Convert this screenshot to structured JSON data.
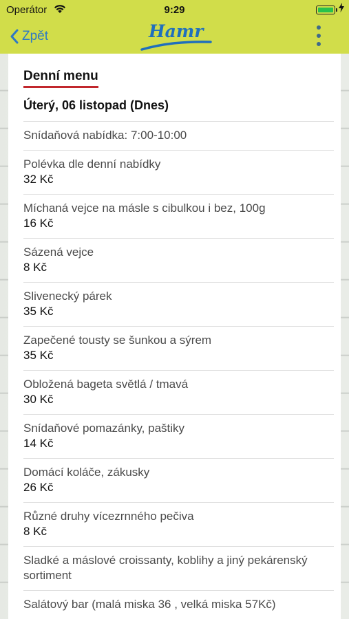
{
  "status_bar": {
    "carrier": "Operátor",
    "time": "9:29"
  },
  "nav": {
    "back_label": "Zpět",
    "logo_text": "Hamr"
  },
  "colors": {
    "topbar": "#d1dd4a",
    "accent_link": "#2e79c4",
    "heading_underline": "#c1272d",
    "logo": "#1f6fbd"
  },
  "page": {
    "heading": "Denní menu",
    "date": "Úterý, 06 listopad (Dnes)"
  },
  "menu_items": [
    {
      "name": "Snídaňová nabídka: 7:00-10:00",
      "price": ""
    },
    {
      "name": "Polévka dle denní nabídky",
      "price": "32 Kč"
    },
    {
      "name": "Míchaná vejce na másle s cibulkou i bez, 100g",
      "price": "16 Kč"
    },
    {
      "name": "Sázená vejce",
      "price": "8 Kč"
    },
    {
      "name": "Slivenecký párek",
      "price": "35 Kč"
    },
    {
      "name": "Zapečené tousty se šunkou a sýrem",
      "price": "35 Kč"
    },
    {
      "name": "Obložená bageta světlá / tmavá",
      "price": "30 Kč"
    },
    {
      "name": "Snídaňové pomazánky, paštiky",
      "price": "14 Kč"
    },
    {
      "name": "Domácí koláče, zákusky",
      "price": "26 Kč"
    },
    {
      "name": "Různé druhy vícezrnného pečiva",
      "price": "8 Kč"
    },
    {
      "name": "Sladké a máslové croissanty, koblihy a jiný pekárenský sortiment",
      "price": ""
    },
    {
      "name": "Salátový bar (malá miska 36 , velká miska 57Kč)",
      "price": ""
    }
  ]
}
